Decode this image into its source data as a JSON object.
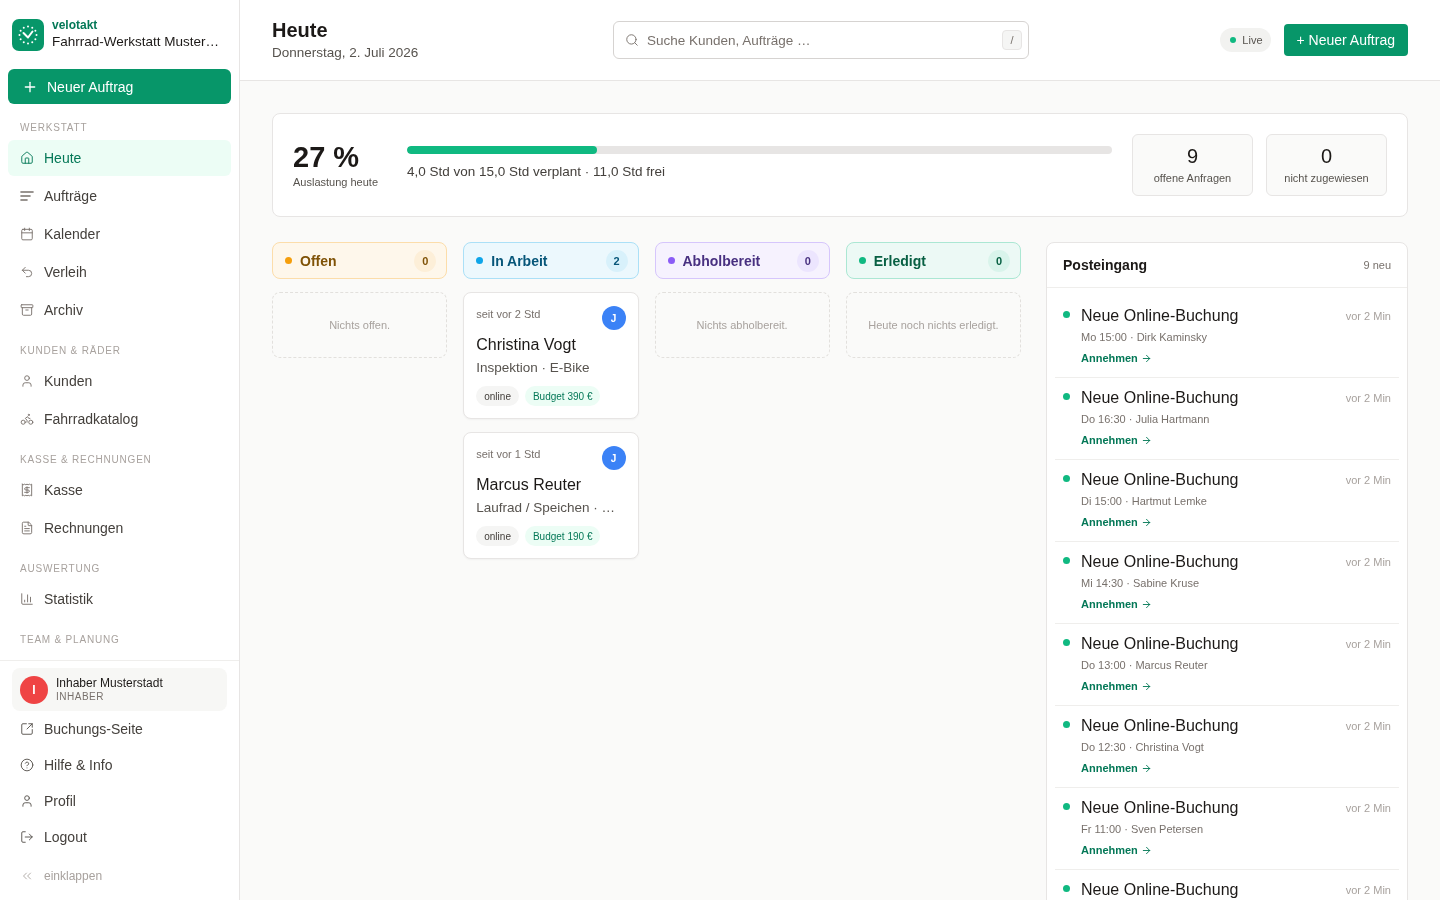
{
  "sidebar": {
    "brand": {
      "name": "velotakt",
      "subtitle": "Fahrrad-Werkstatt Muster…"
    },
    "new_order_button": "Neuer Auftrag",
    "sections": [
      {
        "title": "WERKSTATT",
        "items": [
          {
            "label": "Heute",
            "selected": true
          },
          {
            "label": "Aufträge",
            "selected": false
          },
          {
            "label": "Kalender",
            "selected": false
          },
          {
            "label": "Verleih",
            "selected": false
          },
          {
            "label": "Archiv",
            "selected": false
          }
        ]
      },
      {
        "title": "KUNDEN & RÄDER",
        "items": [
          {
            "label": "Kunden",
            "selected": false
          },
          {
            "label": "Fahrradkatalog",
            "selected": false
          }
        ]
      },
      {
        "title": "KASSE & RECHNUNGEN",
        "items": [
          {
            "label": "Kasse",
            "selected": false
          },
          {
            "label": "Rechnungen",
            "selected": false
          }
        ]
      },
      {
        "title": "AUSWERTUNG",
        "items": [
          {
            "label": "Statistik",
            "selected": false
          }
        ]
      },
      {
        "title": "TEAM & PLANUNG"
      }
    ],
    "user": {
      "initial": "I",
      "name": "Inhaber Musterstadt",
      "role": "INHABER"
    },
    "links": [
      "Buchungs-Seite",
      "Hilfe & Info",
      "Profil",
      "Logout"
    ],
    "collapse": "einklappen"
  },
  "header": {
    "title": "Heute",
    "date": "Donnerstag, 2. Juli 2026",
    "search": {
      "placeholder": "Suche Kunden, Aufträge …",
      "shortcut": "/"
    },
    "live": "Live",
    "new_order_button": "+ Neuer Auftrag"
  },
  "utilization": {
    "value": "27 %",
    "label": "Auslastung heute",
    "level": 0.27,
    "summary": "4,0 Std von 15,0 Std verplant · 11,0 Std frei",
    "stats": [
      {
        "value": "9",
        "label": "offene Anfragen"
      },
      {
        "value": "0",
        "label": "nicht zugewiesen"
      }
    ]
  },
  "board": {
    "columns": [
      {
        "title": "Offen",
        "count": "0",
        "color": "#f59e0b",
        "empty": "Nichts offen."
      },
      {
        "title": "In Arbeit",
        "count": "2",
        "color": "#0ea5e9",
        "cards": [
          {
            "since": "seit vor 2 Std",
            "assignee": "J",
            "customer": "Christina Vogt",
            "service": "Inspektion · E-Bike",
            "source": "online",
            "budget": "Budget 390 €"
          },
          {
            "since": "seit vor 1 Std",
            "assignee": "J",
            "customer": "Marcus Reuter",
            "service": "Laufrad / Speichen · …",
            "source": "online",
            "budget": "Budget 190 €"
          }
        ]
      },
      {
        "title": "Abholbereit",
        "count": "0",
        "color": "#8b5cf6",
        "empty": "Nichts abholbereit."
      },
      {
        "title": "Erledigt",
        "count": "0",
        "color": "#10b981",
        "empty": "Heute noch nichts erledigt."
      }
    ]
  },
  "inbox": {
    "title": "Posteingang",
    "count": "9 neu",
    "items": [
      {
        "title": "Neue Online-Buchung",
        "time": "vor 2 Min",
        "details": "Mo 15:00 · Dirk Kaminsky",
        "action": "Annehmen",
        "unread": true
      },
      {
        "title": "Neue Online-Buchung",
        "time": "vor 2 Min",
        "details": "Do 16:30 · Julia Hartmann",
        "action": "Annehmen",
        "unread": true
      },
      {
        "title": "Neue Online-Buchung",
        "time": "vor 2 Min",
        "details": "Di 15:00 · Hartmut Lemke",
        "action": "Annehmen",
        "unread": true
      },
      {
        "title": "Neue Online-Buchung",
        "time": "vor 2 Min",
        "details": "Mi 14:30 · Sabine Kruse",
        "action": "Annehmen",
        "unread": true
      },
      {
        "title": "Neue Online-Buchung",
        "time": "vor 2 Min",
        "details": "Do 13:00 · Marcus Reuter",
        "action": "Annehmen",
        "unread": true
      },
      {
        "title": "Neue Online-Buchung",
        "time": "vor 2 Min",
        "details": "Do 12:30 · Christina Vogt",
        "action": "Annehmen",
        "unread": true
      },
      {
        "title": "Neue Online-Buchung",
        "time": "vor 2 Min",
        "details": "Fr 11:00 · Sven Petersen",
        "action": "Annehmen",
        "unread": true
      },
      {
        "title": "Neue Online-Buchung",
        "time": "vor 2 Min",
        "unread": true
      }
    ]
  }
}
